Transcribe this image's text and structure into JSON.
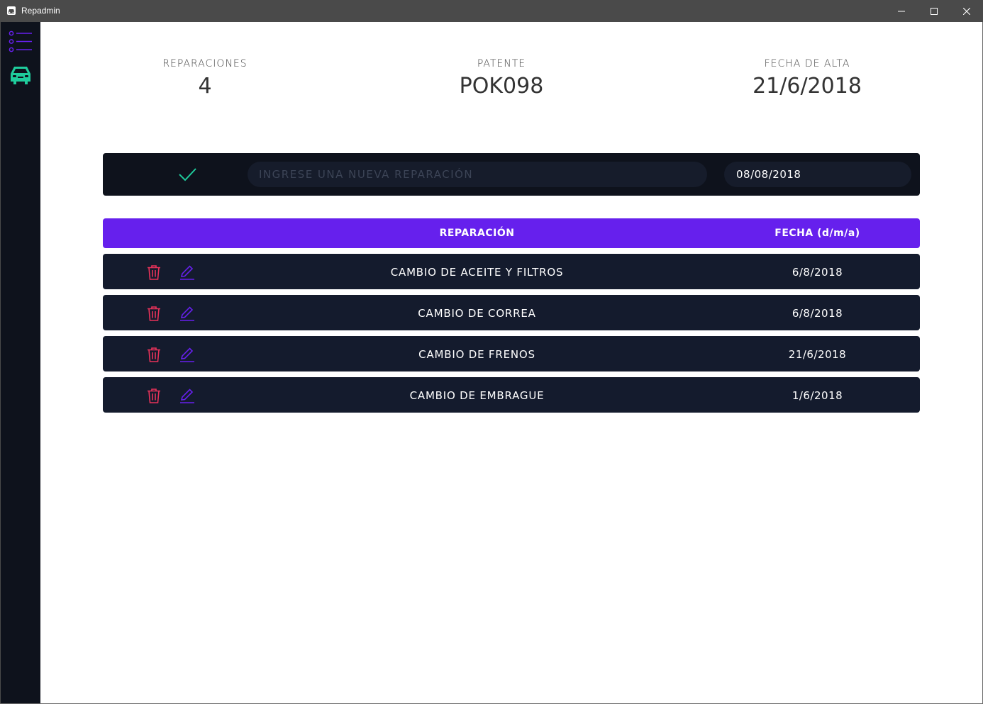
{
  "window": {
    "title": "Repadmin",
    "icon": "car-icon",
    "controls": [
      "minimize-icon",
      "maximize-icon",
      "close-icon"
    ]
  },
  "sidebar": {
    "items": [
      {
        "icon": "list-icon",
        "color": "#6620ed"
      },
      {
        "icon": "car-icon",
        "color": "#1fcc9c"
      }
    ]
  },
  "stats": {
    "repairs_label": "REPARACIONES",
    "repairs_value": "4",
    "plate_label": "PATENTE",
    "plate_value": "POK098",
    "date_label": "FECHA DE ALTA",
    "date_value": "21/6/2018"
  },
  "form": {
    "confirm_icon": "check-icon",
    "repair_placeholder": "INGRESE UNA NUEVA REPARACIÓN",
    "repair_value": "",
    "date_value": "08/08/2018"
  },
  "table": {
    "headers": {
      "repair": "REPARACIÓN",
      "date": "FECHA (d/m/a)"
    },
    "rows": [
      {
        "repair": "CAMBIO DE ACEITE Y FILTROS",
        "date": "6/8/2018"
      },
      {
        "repair": "CAMBIO DE CORREA",
        "date": "6/8/2018"
      },
      {
        "repair": "CAMBIO DE FRENOS",
        "date": "21/6/2018"
      },
      {
        "repair": "CAMBIO DE EMBRAGUE",
        "date": "1/6/2018"
      }
    ]
  },
  "colors": {
    "accent": "#6620ed",
    "success": "#1fcc9c",
    "danger": "#e8325a",
    "dark_bg": "#0e121c",
    "row_bg": "#141b2d"
  }
}
